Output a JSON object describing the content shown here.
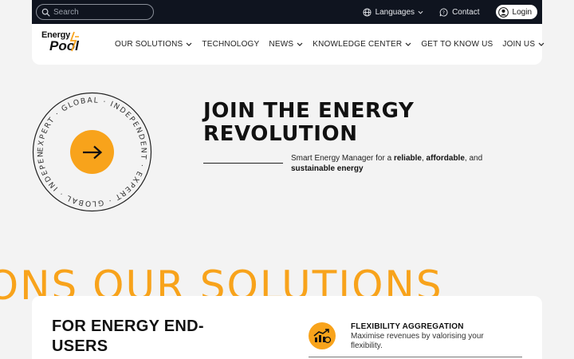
{
  "search": {
    "placeholder": "Search"
  },
  "topbar": {
    "languages_label": "Languages",
    "contact_label": "Contact",
    "login_label": "Login"
  },
  "logo": {
    "line1": "Energy",
    "line2": "Pool"
  },
  "nav": {
    "items": [
      {
        "label": "OUR SOLUTIONS",
        "dropdown": true
      },
      {
        "label": "TECHNOLOGY",
        "dropdown": false
      },
      {
        "label": "NEWS",
        "dropdown": true
      },
      {
        "label": "KNOWLEDGE CENTER",
        "dropdown": true
      },
      {
        "label": "GET TO KNOW US",
        "dropdown": false
      },
      {
        "label": "JOIN US",
        "dropdown": true
      }
    ]
  },
  "badge": {
    "ring_text": "EXPERT · GLOBAL · INDEPENDENT · EXPERT · GLOBAL · INDEPENDENT ·"
  },
  "hero": {
    "title_line1": "JOIN THE ENERGY",
    "title_line2": "REVOLUTION",
    "sub_prefix": "Smart Energy Manager for a ",
    "sub_bold1": "reliable",
    "sub_sep1": ", ",
    "sub_bold2": "affordable",
    "sub_sep2": ", and ",
    "sub_bold3": "sustainable energy"
  },
  "marquee": {
    "text": "IONS   OUR SOLUTIONS"
  },
  "card": {
    "title": "FOR ENERGY END-USERS",
    "feature_title": "FLEXIBILITY AGGREGATION",
    "feature_desc": "Maximise revenues by valorising your flexibility."
  },
  "colors": {
    "accent": "#f8a31b",
    "dark": "#0f141f",
    "background": "#f3f3f3"
  }
}
